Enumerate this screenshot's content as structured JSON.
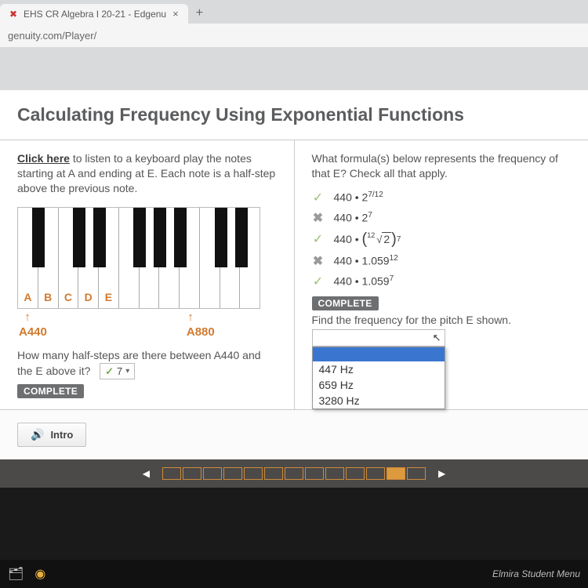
{
  "browser": {
    "tab_title": "EHS CR Algebra I 20-21 - Edgenu",
    "favicon": "✖",
    "url": "genuity.com/Player/"
  },
  "lesson": {
    "title": "Calculating Frequency Using Exponential Functions"
  },
  "left": {
    "click_here": "Click here",
    "intro_rest": " to listen to a keyboard play the notes starting at A and ending at E. Each note is a half-step above the previous note.",
    "notes": [
      "A",
      "B",
      "C",
      "D",
      "E"
    ],
    "a440": "A440",
    "a880": "A880",
    "question": "How many half-steps are there between A440 and the E above it?",
    "answer_value": "7",
    "complete": "COMPLETE"
  },
  "right": {
    "prompt": "What formula(s) below represents the frequency of that E? Check all that apply.",
    "opt1": "440 • 2",
    "opt1_exp": "7/12",
    "opt2": "440 • 2",
    "opt2_exp": "7",
    "opt3_pre": "440 •",
    "opt3_root_inner": "2",
    "opt3_exp": "7",
    "opt4": "440 • 1.059",
    "opt4_exp": "12",
    "opt5": "440 • 1.059",
    "opt5_exp": "7",
    "complete": "COMPLETE",
    "find": "Find the frequency for the pitch E shown.",
    "dropdown": {
      "options": [
        "447 Hz",
        "659 Hz",
        "3280 Hz"
      ]
    }
  },
  "footer": {
    "intro_btn": "Intro"
  },
  "taskbar": {
    "menu": "Elmira Student Menu"
  }
}
